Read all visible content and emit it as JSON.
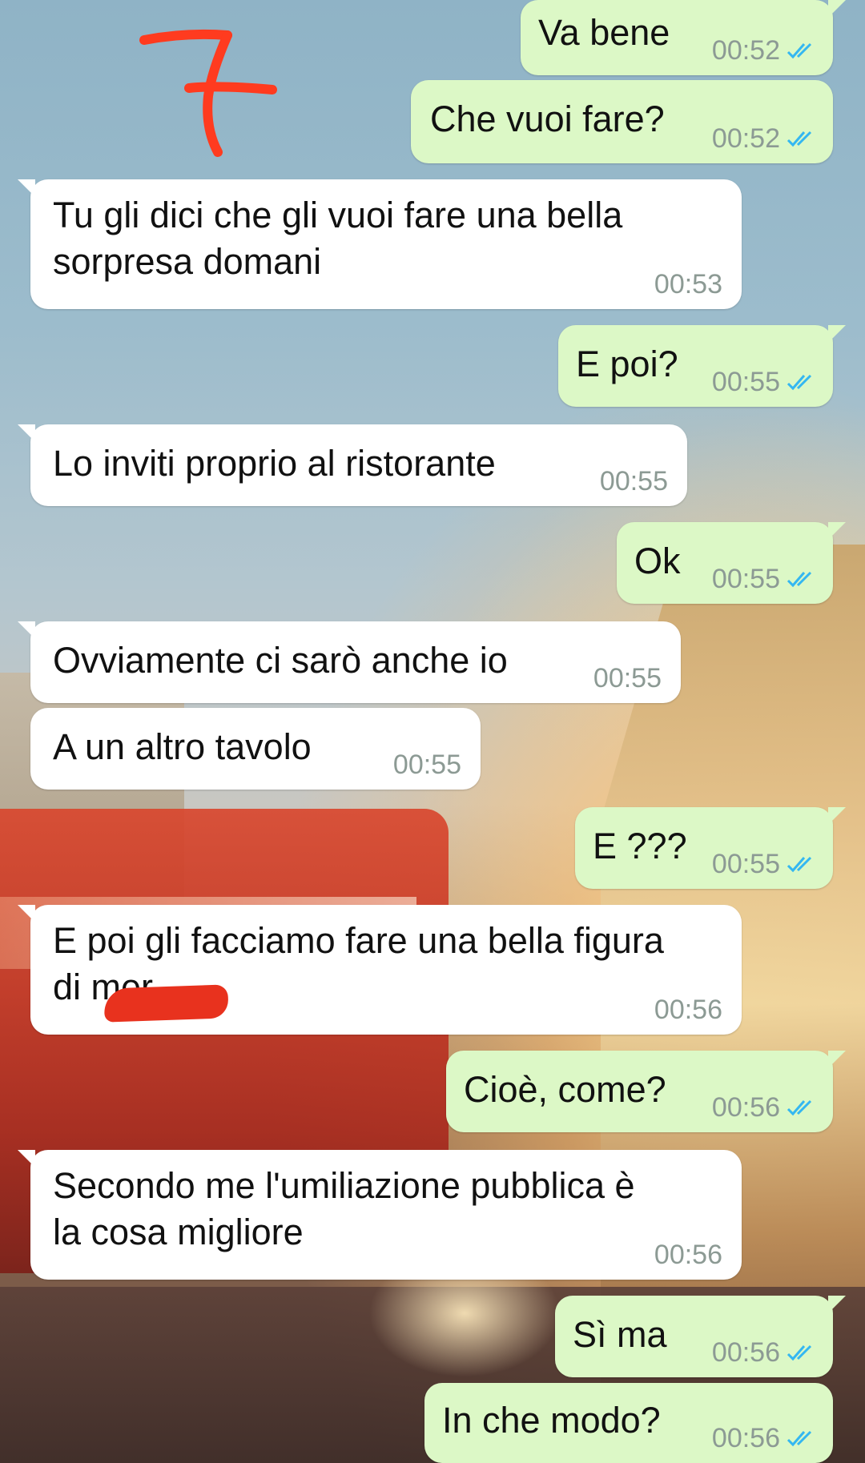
{
  "annotation": {
    "label": "7",
    "color": "#ff3b1f"
  },
  "colors": {
    "incoming": "#ffffff",
    "outgoing": "#dcf8c6",
    "tick": "#34b7f1",
    "time": "#8c9a94"
  },
  "messages": [
    {
      "dir": "out",
      "text": "Va bene",
      "time": "00:52",
      "ticks": "double-check-icon"
    },
    {
      "dir": "out",
      "text": "Che vuoi fare?",
      "time": "00:52",
      "ticks": "double-check-icon"
    },
    {
      "dir": "in",
      "text": "Tu gli dici che gli vuoi fare una bella\nsorpresa domani",
      "time": "00:53"
    },
    {
      "dir": "out",
      "text": "E poi?",
      "time": "00:55",
      "ticks": "double-check-icon"
    },
    {
      "dir": "in",
      "text": "Lo inviti proprio al ristorante",
      "time": "00:55"
    },
    {
      "dir": "out",
      "text": "Ok",
      "time": "00:55",
      "ticks": "double-check-icon"
    },
    {
      "dir": "in",
      "text": "Ovviamente ci sarò anche io",
      "time": "00:55"
    },
    {
      "dir": "in",
      "text": "A un altro tavolo",
      "time": "00:55"
    },
    {
      "dir": "out",
      "text": "E ???",
      "time": "00:55",
      "ticks": "double-check-icon"
    },
    {
      "dir": "in",
      "text": "E poi gli facciamo fare una bella figura\ndi mer",
      "time": "00:56"
    },
    {
      "dir": "out",
      "text": "Cioè, come?",
      "time": "00:56",
      "ticks": "double-check-icon"
    },
    {
      "dir": "in",
      "text": "Secondo me l'umiliazione pubblica è\nla cosa migliore",
      "time": "00:56"
    },
    {
      "dir": "out",
      "text": "Sì ma",
      "time": "00:56",
      "ticks": "double-check-icon"
    },
    {
      "dir": "out",
      "text": "In che modo?",
      "time": "00:56",
      "ticks": "double-check-icon"
    }
  ]
}
